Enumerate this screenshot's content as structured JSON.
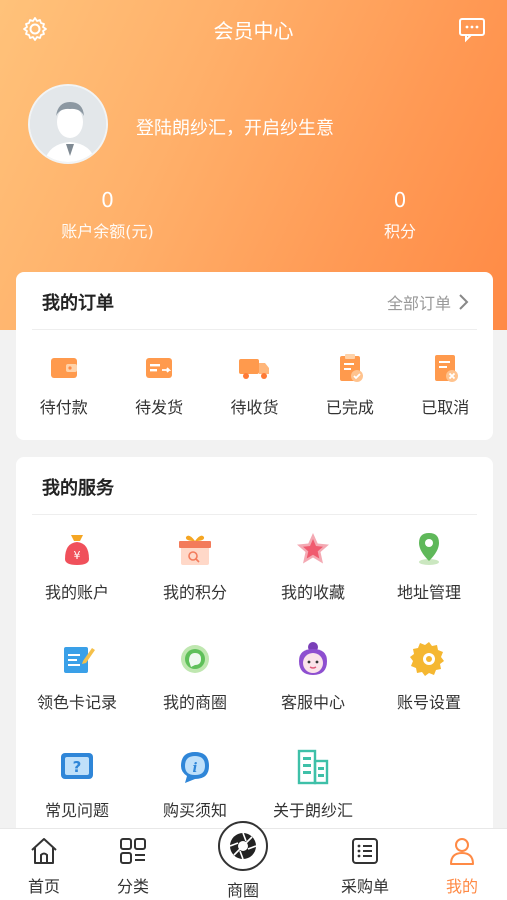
{
  "header": {
    "title": "会员中心",
    "login_prompt": "登陆朗纱汇，开启纱生意",
    "balance_value": "0",
    "balance_label": "账户余额(元)",
    "points_value": "0",
    "points_label": "积分"
  },
  "orders": {
    "title": "我的订单",
    "all_label": "全部订单",
    "items": [
      {
        "label": "待付款",
        "icon": "wallet-icon"
      },
      {
        "label": "待发货",
        "icon": "card-send-icon"
      },
      {
        "label": "待收货",
        "icon": "truck-icon"
      },
      {
        "label": "已完成",
        "icon": "clipboard-check-icon"
      },
      {
        "label": "已取消",
        "icon": "document-cancel-icon"
      }
    ]
  },
  "services": {
    "title": "我的服务",
    "items": [
      {
        "label": "我的账户",
        "icon": "money-bag-icon"
      },
      {
        "label": "我的积分",
        "icon": "gift-box-icon"
      },
      {
        "label": "我的收藏",
        "icon": "star-icon"
      },
      {
        "label": "地址管理",
        "icon": "location-pin-icon"
      },
      {
        "label": "领色卡记录",
        "icon": "note-edit-icon"
      },
      {
        "label": "我的商圈",
        "icon": "chat-bubble-icon"
      },
      {
        "label": "客服中心",
        "icon": "customer-service-icon"
      },
      {
        "label": "账号设置",
        "icon": "gear-icon"
      },
      {
        "label": "常见问题",
        "icon": "question-icon"
      },
      {
        "label": "购买须知",
        "icon": "info-icon"
      },
      {
        "label": "关于朗纱汇",
        "icon": "building-icon"
      }
    ]
  },
  "tabbar": {
    "items": [
      {
        "label": "首页",
        "icon": "home-icon"
      },
      {
        "label": "分类",
        "icon": "category-icon"
      },
      {
        "label": "商圈",
        "icon": "aperture-icon"
      },
      {
        "label": "采购单",
        "icon": "list-icon"
      },
      {
        "label": "我的",
        "icon": "person-icon"
      }
    ],
    "active": "我的"
  },
  "colors": {
    "accent": "#ff8a45",
    "header_start": "#ffc27a",
    "header_end": "#ff8a45"
  }
}
